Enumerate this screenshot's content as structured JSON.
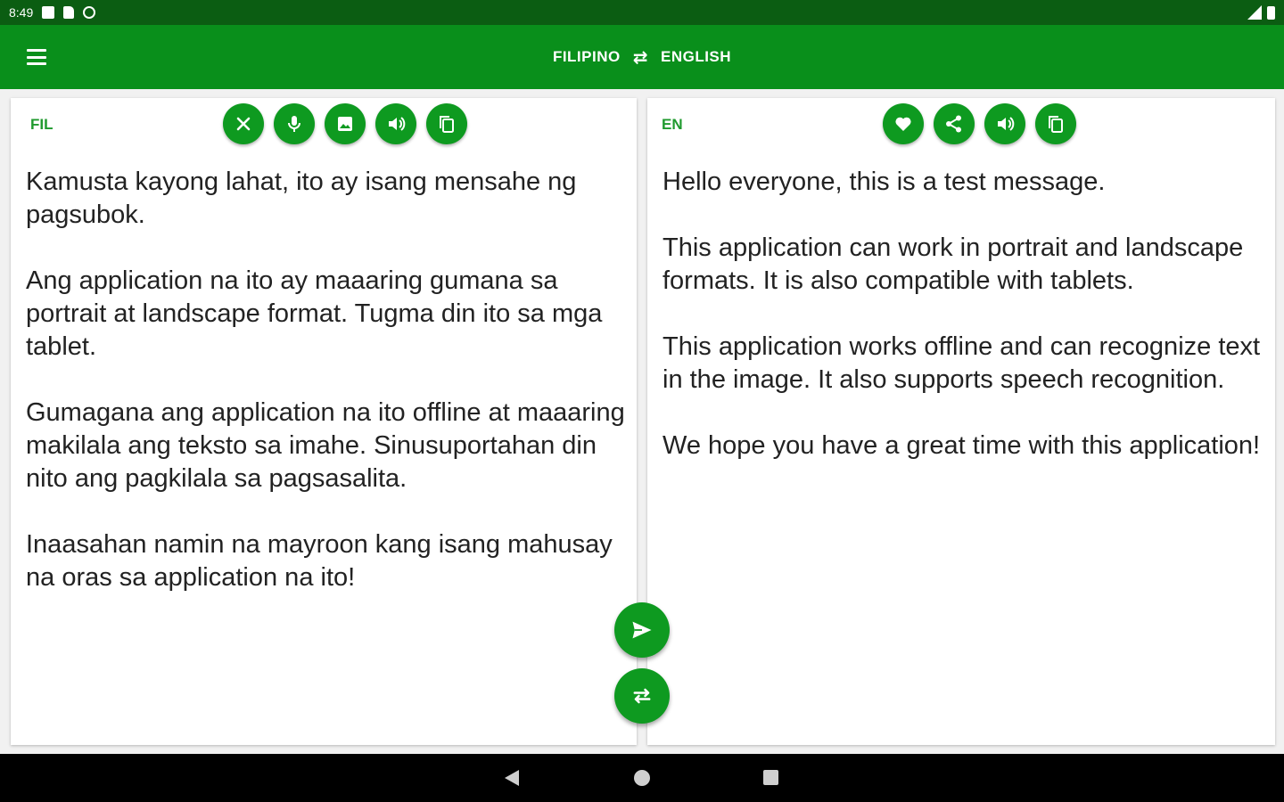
{
  "status_bar": {
    "time": "8:49",
    "icons": [
      "notification-icon",
      "sd-card-icon",
      "sync-icon"
    ],
    "right_icons": [
      "signal-icon",
      "battery-icon"
    ]
  },
  "app_bar": {
    "menu_icon": "menu-icon",
    "source_language": "FILIPINO",
    "swap_icon": "swap-arrows-icon",
    "target_language": "ENGLISH"
  },
  "source_panel": {
    "code": "FIL",
    "tools": [
      "clear-icon",
      "mic-icon",
      "image-icon",
      "speaker-icon",
      "copy-icon"
    ],
    "text": "Kamusta kayong lahat, ito ay isang mensahe ng pagsubok.\n\nAng application na ito ay maaaring gumana sa portrait at landscape format. Tugma din ito sa mga tablet.\n\nGumagana ang application na ito offline at maaaring makilala ang teksto sa imahe. Sinusuportahan din nito ang pagkilala sa pagsasalita.\n\nInaasahan namin na mayroon kang isang mahusay na oras sa application na ito!"
  },
  "target_panel": {
    "code": "EN",
    "tools": [
      "favorite-icon",
      "share-icon",
      "speaker-icon",
      "copy-icon"
    ],
    "text": "Hello everyone, this is a test message.\n\nThis application can work in portrait and landscape formats. It is also compatible with tablets.\n\nThis application works offline and can recognize text in the image. It also supports speech recognition.\n\nWe hope you have a great time with this application!"
  },
  "fabs": {
    "translate_icon": "send-icon",
    "swap_icon": "swap-icon"
  },
  "nav_bar": {
    "icons": [
      "back-icon",
      "home-icon",
      "recents-icon"
    ]
  },
  "colors": {
    "status_bar": "#0b5d12",
    "app_bar": "#098f1b",
    "accent": "#0e9a20"
  }
}
